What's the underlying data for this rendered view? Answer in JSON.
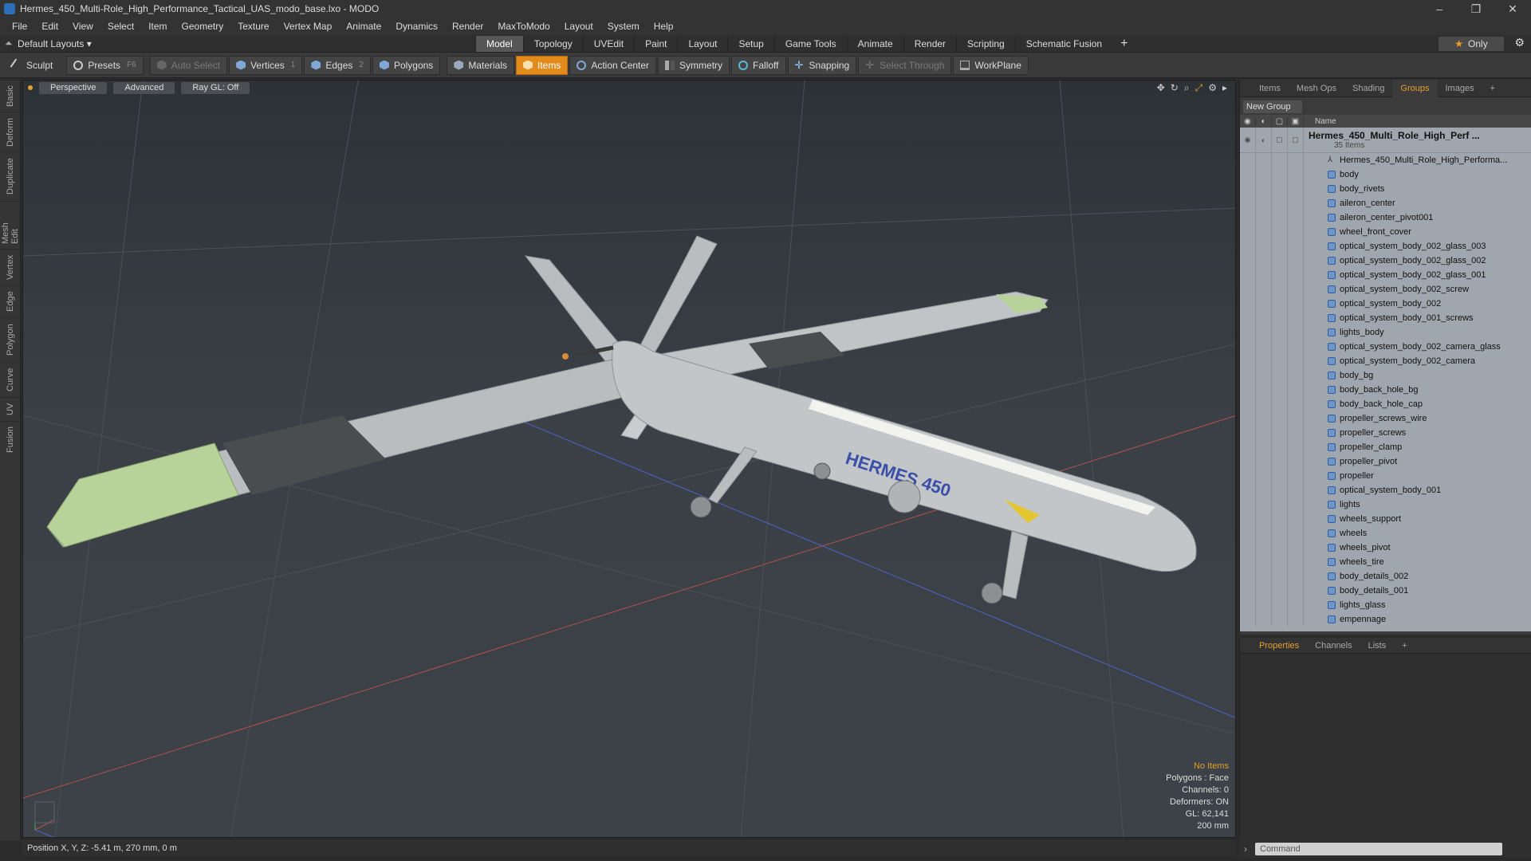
{
  "window": {
    "title": "Hermes_450_Multi-Role_High_Performance_Tactical_UAS_modo_base.lxo - MODO",
    "minimize": "–",
    "maximize": "❐",
    "close": "✕"
  },
  "menu": [
    "File",
    "Edit",
    "View",
    "Select",
    "Item",
    "Geometry",
    "Texture",
    "Vertex Map",
    "Animate",
    "Dynamics",
    "Render",
    "MaxToModo",
    "Layout",
    "System",
    "Help"
  ],
  "layoutbar": {
    "layout": "Default Layouts ▾",
    "tabs": [
      "Model",
      "Topology",
      "UVEdit",
      "Paint",
      "Layout",
      "Setup",
      "Game Tools",
      "Animate",
      "Render",
      "Scripting",
      "Schematic Fusion"
    ],
    "active_tab": "Model",
    "only": "Only"
  },
  "toolbar": {
    "sculpt": "Sculpt",
    "presets": "Presets",
    "presets_key": "F6",
    "auto_select": "Auto Select",
    "vertices": "Vertices",
    "vertices_n": "1",
    "edges": "Edges",
    "edges_n": "2",
    "polygons": "Polygons",
    "materials": "Materials",
    "items": "Items",
    "action_center": "Action Center",
    "symmetry": "Symmetry",
    "falloff": "Falloff",
    "snapping": "Snapping",
    "select_through": "Select Through",
    "workplane": "WorkPlane"
  },
  "left_tabs": [
    "Basic",
    "Deform",
    "Duplicate",
    "Mesh Edit",
    "Vertex",
    "Edge",
    "Polygon",
    "Curve",
    "UV",
    "Fusion"
  ],
  "viewport": {
    "view": "Perspective",
    "shading": "Advanced",
    "raygl": "Ray GL: Off",
    "info": {
      "no_items": "No Items",
      "polygons": "Polygons : Face",
      "channels": "Channels: 0",
      "deformers": "Deformers: ON",
      "gl": "GL: 62,141",
      "scale": "200 mm"
    },
    "hull_text": "HERMES 450",
    "colors": {
      "wing": "#b9bdc0",
      "tip": "#b7d39a",
      "dark": "#4a4d50",
      "bg": "#363c41"
    }
  },
  "statusbar": {
    "position": "Position X, Y, Z:  -5.41 m, 270 mm, 0 m"
  },
  "right_panel": {
    "tabs": [
      "Items",
      "Mesh Ops",
      "Shading",
      "Groups",
      "Images"
    ],
    "active_tab": "Groups",
    "new_group": "New Group",
    "col_name": "Name",
    "group_name": "Hermes_450_Multi_Role_High_Perf ...",
    "group_count": "35 Items",
    "items": [
      "Hermes_450_Multi_Role_High_Performa...",
      "body",
      "body_rivets",
      "aileron_center",
      "aileron_center_pivot001",
      "wheel_front_cover",
      "optical_system_body_002_glass_003",
      "optical_system_body_002_glass_002",
      "optical_system_body_002_glass_001",
      "optical_system_body_002_screw",
      "optical_system_body_002",
      "optical_system_body_001_screws",
      "lights_body",
      "optical_system_body_002_camera_glass",
      "optical_system_body_002_camera",
      "body_bg",
      "body_back_hole_bg",
      "body_back_hole_cap",
      "propeller_screws_wire",
      "propeller_screws",
      "propeller_clamp",
      "propeller_pivot",
      "propeller",
      "optical_system_body_001",
      "lights",
      "wheels_support",
      "wheels",
      "wheels_pivot",
      "wheels_tire",
      "body_details_002",
      "body_details_001",
      "lights_glass",
      "empennage"
    ]
  },
  "props_panel": {
    "tabs": [
      "Properties",
      "Channels",
      "Lists"
    ],
    "active_tab": "Properties"
  },
  "command": {
    "placeholder": "Command"
  }
}
